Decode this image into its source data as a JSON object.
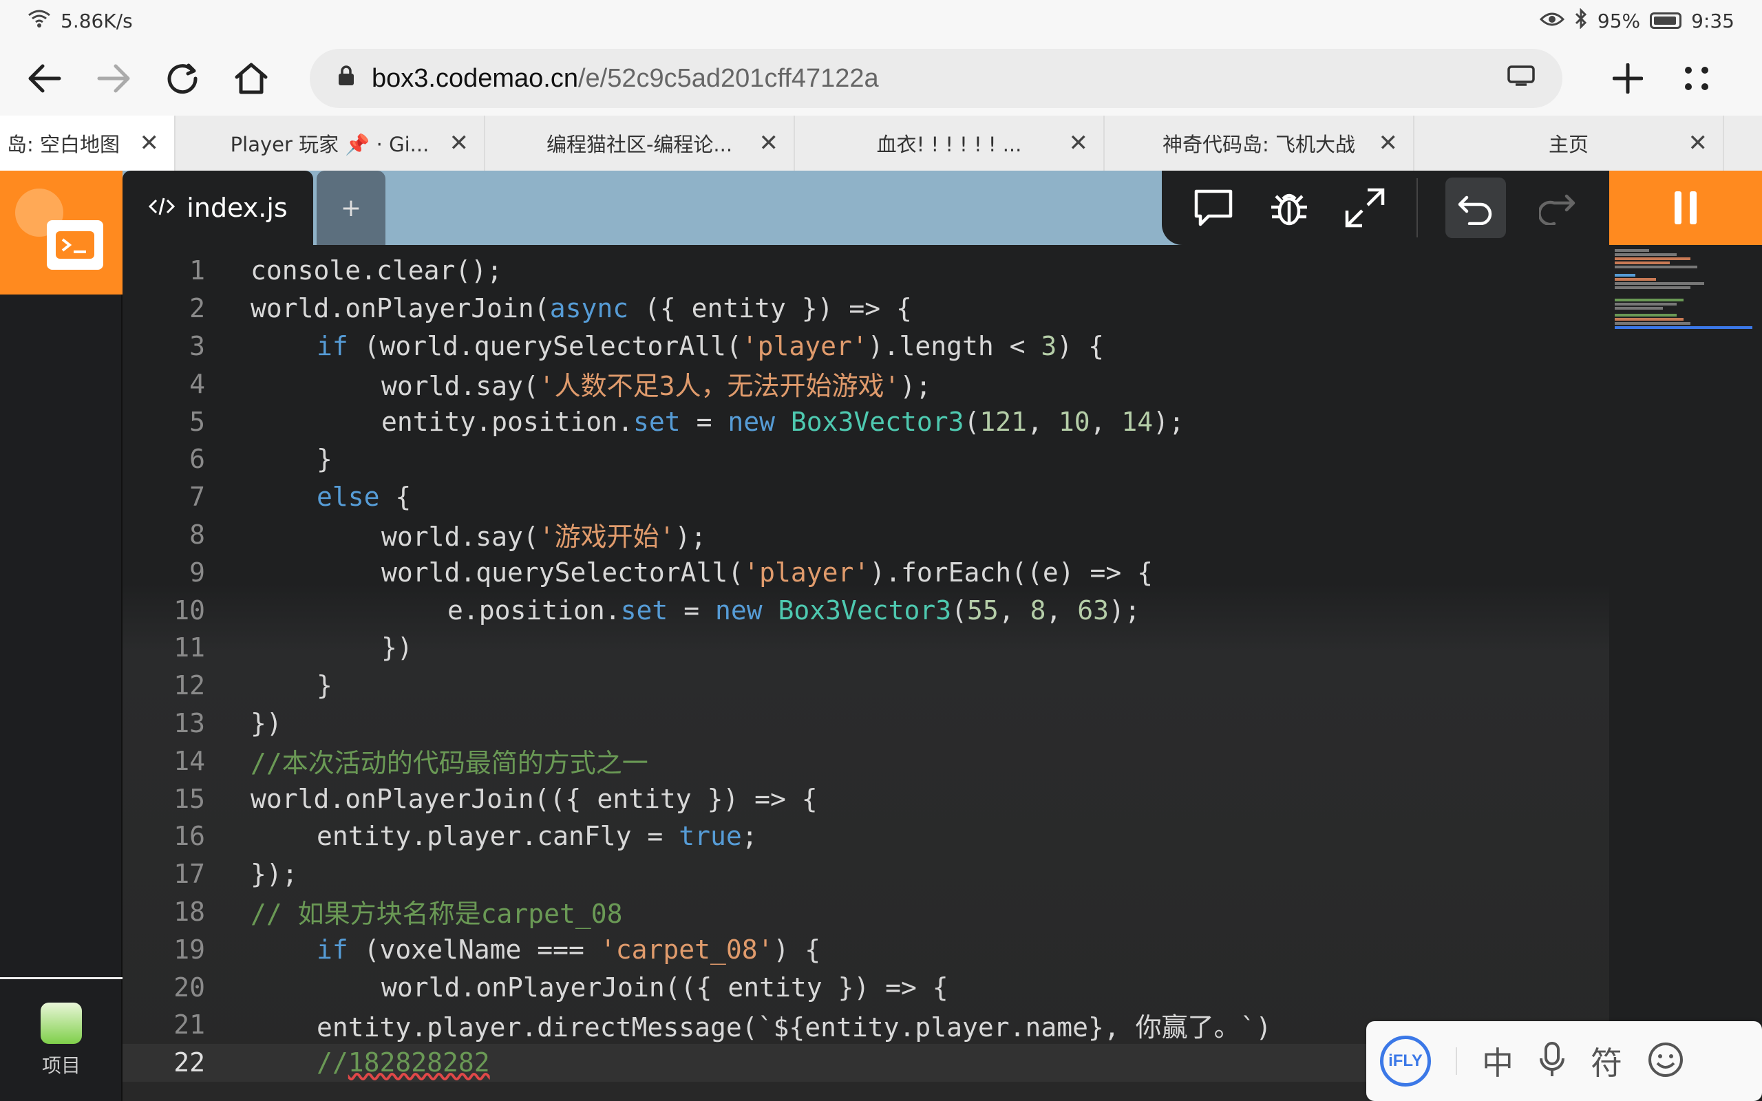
{
  "status": {
    "speed": "5.86K/s",
    "battery": "95%",
    "time": "9:35"
  },
  "browser": {
    "url_domain": "box3.codemao.cn",
    "url_path": "/e/52c9c5ad201cff47122a",
    "tabs": [
      {
        "title": "岛: 空白地图"
      },
      {
        "title": "Player 玩家 📌 · Gi..."
      },
      {
        "title": "编程猫社区-编程论..."
      },
      {
        "title": "血衣! ! ! ! ! ! ..."
      },
      {
        "title": "神奇代码岛: 飞机大战"
      },
      {
        "title": "主页"
      }
    ]
  },
  "editor": {
    "file_tab": "index.js",
    "add_tab": "+",
    "lines": [
      {
        "n": "1"
      },
      {
        "n": "2"
      },
      {
        "n": "3"
      },
      {
        "n": "4"
      },
      {
        "n": "5"
      },
      {
        "n": "6"
      },
      {
        "n": "7"
      },
      {
        "n": "8"
      },
      {
        "n": "9"
      },
      {
        "n": "10"
      },
      {
        "n": "11"
      },
      {
        "n": "12"
      },
      {
        "n": "13"
      },
      {
        "n": "14"
      },
      {
        "n": "15"
      },
      {
        "n": "16"
      },
      {
        "n": "17"
      },
      {
        "n": "18"
      },
      {
        "n": "19"
      },
      {
        "n": "20"
      },
      {
        "n": "21"
      },
      {
        "n": "22"
      }
    ],
    "tokens": {
      "l1": "console.clear();",
      "l2a": "world.onPlayerJoin(",
      "l2b": "async",
      "l2c": " ({ entity }) => {",
      "l3a": "if",
      "l3b": " (world.querySelectorAll(",
      "l3c": "'player'",
      "l3d": ").length < ",
      "l3e": "3",
      "l3f": ") {",
      "l4a": "world.say(",
      "l4b": "'人数不足3人，无法开始游戏'",
      "l4c": ");",
      "l5a": "entity.position.",
      "l5b": "set",
      "l5c": " = ",
      "l5d": "new",
      "l5e": " ",
      "l5f": "Box3Vector3",
      "l5g": "(",
      "l5h": "121",
      "l5i": ", ",
      "l5j": "10",
      "l5k": ", ",
      "l5l": "14",
      "l5m": ");",
      "l6": "}",
      "l7a": "else",
      "l7b": " {",
      "l8a": "world.say(",
      "l8b": "'游戏开始'",
      "l8c": ");",
      "l9a": "world.querySelectorAll(",
      "l9b": "'player'",
      "l9c": ").forEach((e) => {",
      "l10a": "e.position.",
      "l10b": "set",
      "l10c": " = ",
      "l10d": "new",
      "l10e": " ",
      "l10f": "Box3Vector3",
      "l10g": "(",
      "l10h": "55",
      "l10i": ", ",
      "l10j": "8",
      "l10k": ", ",
      "l10l": "63",
      "l10m": ");",
      "l11": "})",
      "l12": "}",
      "l13": "})",
      "l14": "//本次活动的代码最简的方式之一",
      "l15": "world.onPlayerJoin(({ entity }) => {",
      "l16a": "entity.player.canFly = ",
      "l16b": "true",
      "l16c": ";",
      "l17": "});",
      "l18": "// 如果方块名称是carpet_08",
      "l19a": "if",
      "l19b": " (voxelName === ",
      "l19c": "'carpet_08'",
      "l19d": ") {",
      "l20": "world.onPlayerJoin(({ entity }) => {",
      "l21": "entity.player.directMessage(`${entity.player.name}, 你赢了。`)",
      "l22a": "//",
      "l22b": "182828282"
    }
  },
  "sidebar": {
    "project_label": "项目"
  },
  "ime": {
    "brand": "iFLY",
    "mode": "中",
    "symbol": "符"
  },
  "colors": {
    "accent": "#ff8a1f",
    "keyword": "#569cd6",
    "string": "#e09b6c",
    "number": "#b5cea8",
    "class": "#4ec9b0",
    "comment": "#6a9955"
  }
}
